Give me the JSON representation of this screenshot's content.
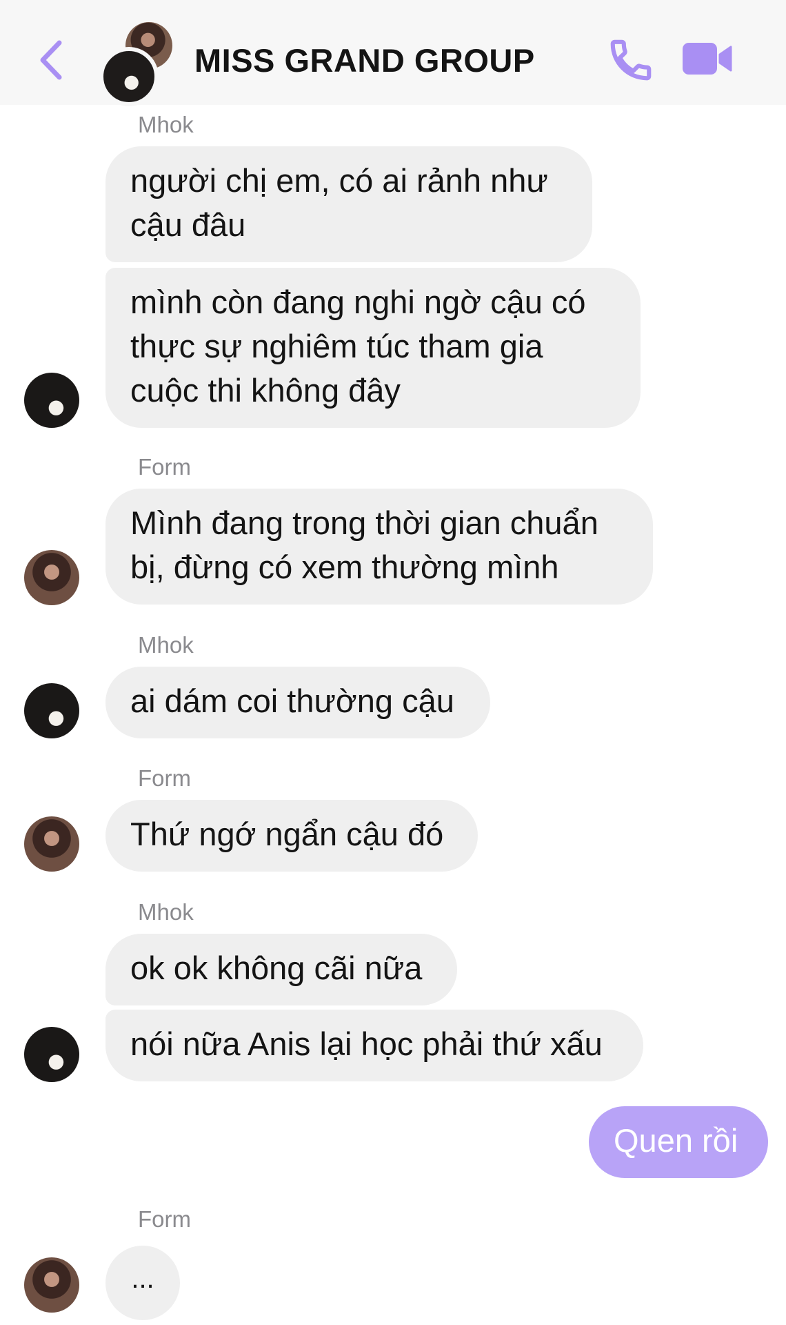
{
  "header": {
    "title": "MISS GRAND GROUP",
    "accent_color": "#a98ff3",
    "icons": {
      "back": "chevron-left-icon",
      "call": "phone-icon",
      "video": "video-camera-icon"
    }
  },
  "messages": [
    {
      "sender": "Mhok",
      "texts": [
        "người chị em, có ai rảnh như",
        "cậu đâu"
      ]
    },
    {
      "texts": [
        "mình còn đang nghi ngờ cậu có",
        "thực sự nghiêm túc tham gia",
        "cuộc thi không đây"
      ]
    },
    {
      "sender": "Form",
      "texts": [
        "Mình đang trong thời gian chuẩn",
        "bị, đừng có xem thường mình"
      ]
    },
    {
      "sender": "Mhok",
      "texts": [
        "ai dám coi thường cậu"
      ]
    },
    {
      "sender": "Form",
      "texts": [
        "Thứ ngớ ngẩn cậu đó"
      ]
    },
    {
      "sender": "Mhok",
      "texts": [
        "ok ok không cãi nữa"
      ]
    },
    {
      "texts": [
        "nói nữa Anis lại học phải thứ xấu"
      ]
    },
    {
      "texts": [
        "Quen rồi"
      ]
    },
    {
      "sender": "Form",
      "texts": [
        "..."
      ]
    }
  ]
}
